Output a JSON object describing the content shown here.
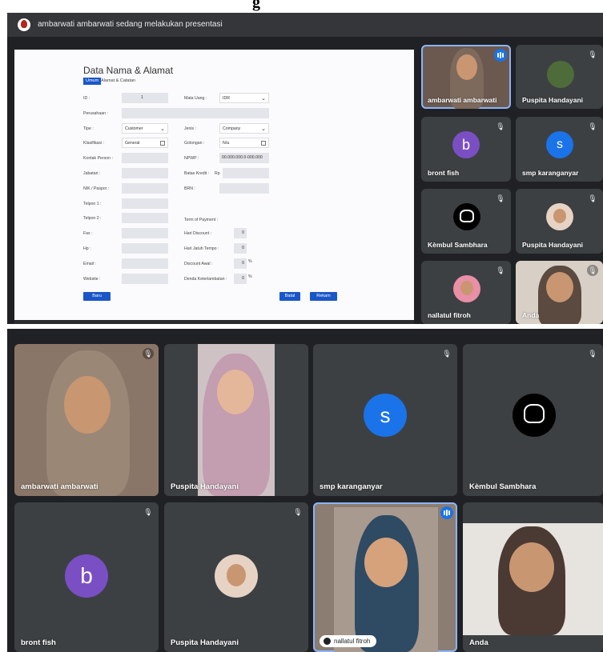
{
  "heading": "g",
  "meeting1": {
    "presenting_text": "ambarwati ambarwati sedang melakukan presentasi",
    "form": {
      "title": "Data Nama & Alamat",
      "tabs": [
        "Umum",
        "Alamat & Catatan"
      ],
      "left_labels": [
        "ID :",
        "Perusahaan :",
        "Tipe :",
        "Klasifikasi :",
        "Kontak Person :",
        "Jabatan :",
        "NIK / Paspor :",
        "Telpon 1 :",
        "Telpon 2 :",
        "Fax :",
        "Hp :",
        "Email :",
        "Website :"
      ],
      "id_value": "1",
      "tipe_value": "Customer",
      "klasifikasi_value": "General",
      "right_labels": {
        "mata_uang": "Mata Uang :",
        "jenis": "Jenis :",
        "golongan": "Golongan :",
        "npwp": "NPWP :",
        "batas_kredit": "Batas Kredit :",
        "brn": "BRN :",
        "term": "Term of Payment :",
        "hari_discount": "Hari Discount :",
        "hari_jatuh_tempo": "Hari Jatuh Tempo :",
        "discount_awal": "Discount Awal :",
        "denda": "Denda Keterlambatan :"
      },
      "mata_uang_value": "IDR",
      "jenis_value": "Company",
      "golongan_value": "N/a",
      "npwp_value": "00.000.000.0-000.000",
      "batas_kredit_prefix": "Rp",
      "hari_discount_value": "0",
      "hari_jatuh_tempo_value": "0",
      "discount_awal_value": "0",
      "denda_value": "0",
      "percent": "%",
      "buttons": {
        "baru": "Baru",
        "batal": "Batal",
        "rekam": "Rekam"
      }
    },
    "tiles": [
      {
        "name": "ambarwati ambarwati"
      },
      {
        "name": "Puspita Handayani"
      },
      {
        "name": "bront fish",
        "letter": "b",
        "color": "#7b4fc4"
      },
      {
        "name": "smp karanganyar",
        "letter": "s",
        "color": "#1a73e8"
      },
      {
        "name": "Kèmbul Sambhara"
      },
      {
        "name": "Puspita Handayani"
      },
      {
        "name": "nallatul fitroh"
      },
      {
        "name": "Anda"
      }
    ]
  },
  "meeting2": {
    "tiles": [
      {
        "name": "ambarwati ambarwati"
      },
      {
        "name": "Puspita Handayani"
      },
      {
        "name": "smp karanganyar",
        "letter": "s",
        "color": "#1a73e8"
      },
      {
        "name": "Kèmbul Sambhara"
      },
      {
        "name": "bront fish",
        "letter": "b",
        "color": "#7b4fc4"
      },
      {
        "name": "Puspita Handayani"
      },
      {
        "name": "nallatul fitroh"
      },
      {
        "name": "Anda"
      }
    ]
  },
  "icons": {
    "mute": "mic-off-icon",
    "speaking": "speaking-indicator-icon",
    "presenter": "presenter-avatar-icon",
    "calendar": "calendar-icon",
    "chevron": "chevron-down-icon"
  }
}
